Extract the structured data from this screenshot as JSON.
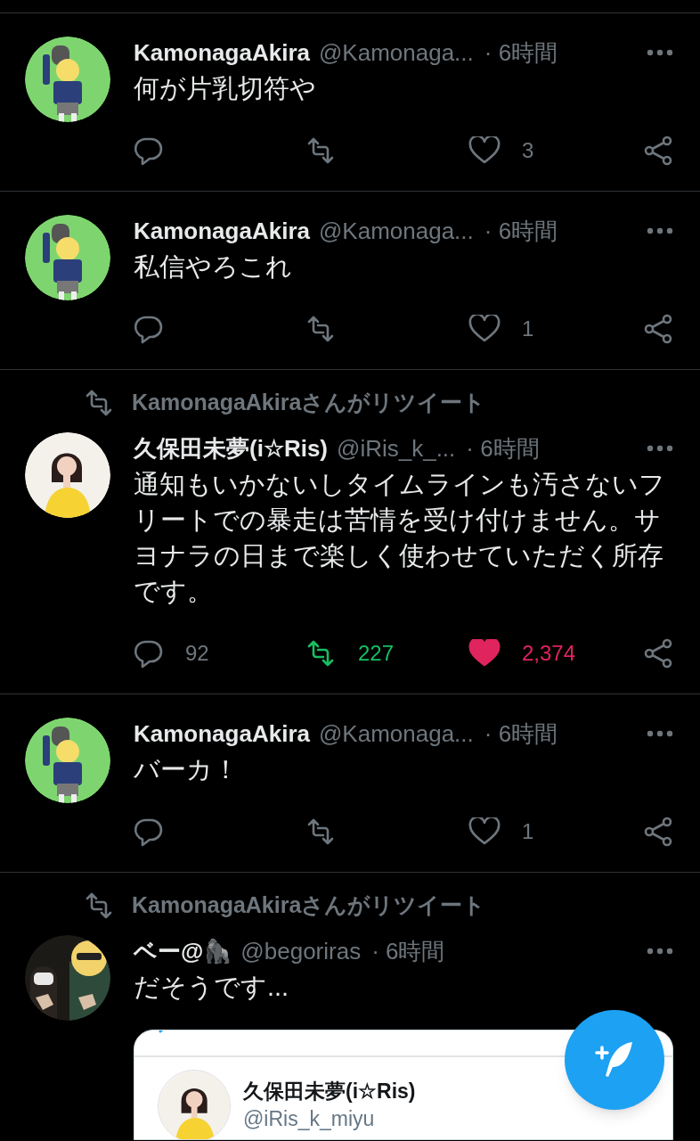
{
  "tweets": [
    {
      "name": "KamonagaAkira",
      "handle": "@Kamonaga...",
      "time": "· 6時間",
      "text": "何が片乳切符や",
      "likes": "3",
      "retweeted": false,
      "liked": false
    },
    {
      "name": "KamonagaAkira",
      "handle": "@Kamonaga...",
      "time": "· 6時間",
      "text": "私信やろこれ",
      "likes": "1",
      "retweeted": false,
      "liked": false
    },
    {
      "retweeted_by": "KamonagaAkiraさんがリツイート",
      "name": "久保田未夢(i☆Ris)",
      "handle": "@iRis_k_...",
      "time": "· 6時間",
      "text": "通知もいかないしタイムラインも汚さないフリートでの暴走は苦情を受け付けません。サヨナラの日まで楽しく使わせていただく所存です。",
      "replies": "92",
      "retweets": "227",
      "likes": "2,374",
      "retweeted": true,
      "liked": true
    },
    {
      "name": "KamonagaAkira",
      "handle": "@Kamonaga...",
      "time": "· 6時間",
      "text": "バーカ！",
      "likes": "1",
      "retweeted": false,
      "liked": false
    },
    {
      "retweeted_by": "KamonagaAkiraさんがリツイート",
      "name": "ベー@🦍",
      "handle": "@begoriras",
      "time": "· 6時間",
      "text": "だそうです...",
      "embed": {
        "name": "久保田未夢(i☆Ris)",
        "handle": "@iRis_k_miyu"
      }
    }
  ]
}
